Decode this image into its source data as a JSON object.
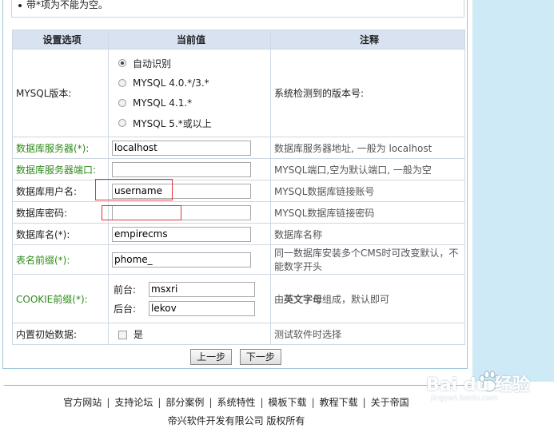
{
  "notice": "带*项为不能为空。",
  "table": {
    "headers": [
      "设置选项",
      "当前值",
      "注释"
    ],
    "mysql_version": {
      "label": "MYSQL版本:",
      "options": [
        "自动识别",
        "MYSQL 4.0.*/3.*",
        "MYSQL 4.1.*",
        "MYSQL 5.*或以上"
      ],
      "selected": "自动识别",
      "note": "系统检测到的版本号:"
    },
    "db_server": {
      "label": "数据库服务器(*):",
      "value": "localhost",
      "note": "数据库服务器地址, 一般为 localhost"
    },
    "db_port": {
      "label": "数据库服务器端口:",
      "value": "",
      "note": "MYSQL端口,空为默认端口, 一般为空"
    },
    "db_user": {
      "label": "数据库用户名:",
      "value": "username",
      "note": "MYSQL数据库链接账号"
    },
    "db_password": {
      "label": "数据库密码:",
      "value": "",
      "note": "MYSQL数据库链接密码"
    },
    "db_name": {
      "label": "数据库名(*):",
      "value": "empirecms",
      "note": "数据库名称"
    },
    "table_prefix": {
      "label": "表名前缀(*):",
      "value": "phome_",
      "note": "同一数据库安装多个CMS时可改变默认，不能数字开头"
    },
    "cookie_prefix": {
      "label": "COOKIE前缀(*):",
      "front_label": "前台:",
      "front_value": "msxri",
      "back_label": "后台:",
      "back_value": "lekov",
      "note_prefix": "由",
      "note_bold": "英文字母",
      "note_suffix": "组成，默认即可"
    },
    "init_data": {
      "label": "内置初始数据:",
      "checkbox_label": "是",
      "note": "测试软件时选择"
    }
  },
  "buttons": {
    "prev": "上一步",
    "next": "下一步"
  },
  "footer": {
    "links": [
      "官方网站",
      "支持论坛",
      "部分案例",
      "系统特性",
      "模板下载",
      "教程下载",
      "关于帝国"
    ],
    "separator": "|",
    "copyright": "帝兴软件开发有限公司 版权所有"
  },
  "watermark": {
    "text": "Bai du 经验",
    "sub": "jingyan.baidu.com"
  },
  "colors": {
    "header_bg": "#d8e2f0",
    "required_label": "#2f8a1b",
    "highlight": "#e0353a",
    "side_band": "#ceeaf6"
  }
}
